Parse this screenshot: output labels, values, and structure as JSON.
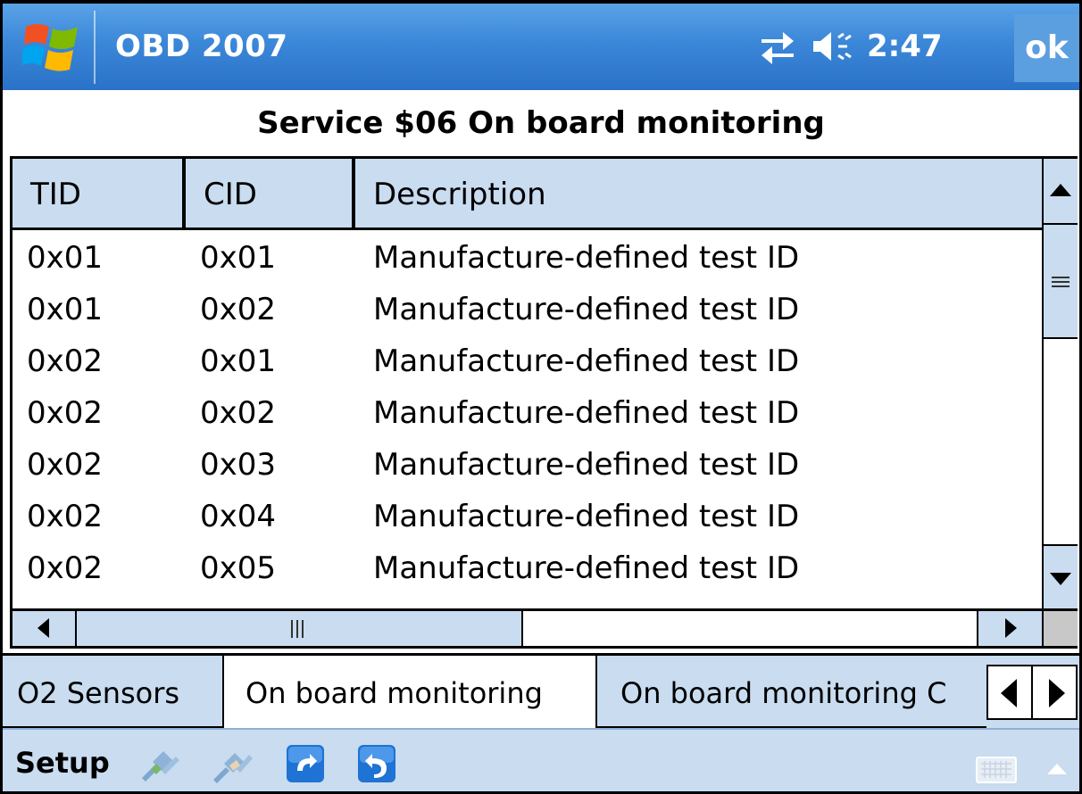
{
  "titlebar": {
    "app_title": "OBD 2007",
    "clock": "2:47",
    "ok_label": "ok",
    "icons": [
      "windows-start-icon",
      "connectivity-icon",
      "volume-icon"
    ]
  },
  "heading": "Service $06 On board monitoring",
  "table": {
    "columns": [
      "TID",
      "CID",
      "Description"
    ],
    "rows": [
      {
        "tid": "0x01",
        "cid": "0x01",
        "desc": "Manufacture-defined test ID"
      },
      {
        "tid": "0x01",
        "cid": "0x02",
        "desc": "Manufacture-defined test ID"
      },
      {
        "tid": "0x02",
        "cid": "0x01",
        "desc": "Manufacture-defined test ID"
      },
      {
        "tid": "0x02",
        "cid": "0x02",
        "desc": "Manufacture-defined test ID"
      },
      {
        "tid": "0x02",
        "cid": "0x03",
        "desc": "Manufacture-defined test ID"
      },
      {
        "tid": "0x02",
        "cid": "0x04",
        "desc": "Manufacture-defined test ID"
      },
      {
        "tid": "0x02",
        "cid": "0x05",
        "desc": "Manufacture-defined test ID"
      }
    ]
  },
  "tabs": [
    "O2 Sensors",
    "On board monitoring",
    "On board monitoring C"
  ],
  "active_tab": 1,
  "menubar": {
    "setup_label": "Setup",
    "icons": [
      "connect-icon",
      "disconnect-icon",
      "refresh-icon",
      "undo-icon",
      "keyboard-icon"
    ]
  },
  "colors": {
    "titlebar_blue": "#3b87d8",
    "panel_blue": "#c9dcf0",
    "ok_blue": "#5c9fe0"
  }
}
